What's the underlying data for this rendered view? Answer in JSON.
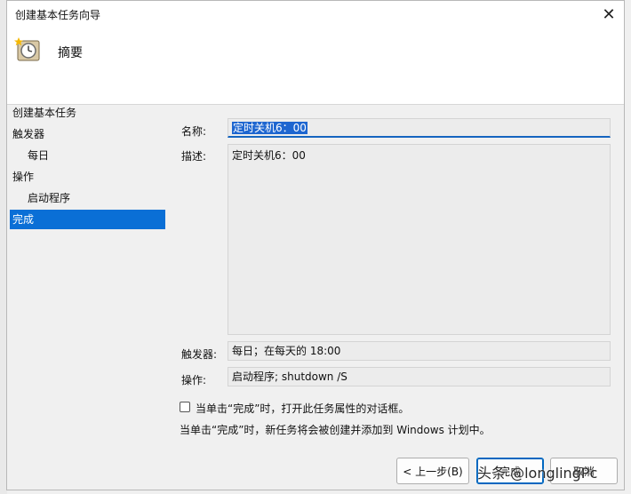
{
  "window": {
    "title": "创建基本任务向导",
    "close_glyph": "✕"
  },
  "header": {
    "title": "摘要",
    "icon": "clock-schedule-icon"
  },
  "nav": {
    "items": [
      {
        "label": "创建基本任务",
        "level": 0,
        "active": false
      },
      {
        "label": "触发器",
        "level": 0,
        "active": false
      },
      {
        "label": "每日",
        "level": 1,
        "active": false
      },
      {
        "label": "操作",
        "level": 0,
        "active": false
      },
      {
        "label": "启动程序",
        "level": 1,
        "active": false
      },
      {
        "label": "完成",
        "level": 0,
        "active": true
      }
    ]
  },
  "form": {
    "name_label": "名称:",
    "name_value": "定时关机6：00",
    "desc_label": "描述:",
    "desc_value": "定时关机6：00",
    "trigger_label": "触发器:",
    "trigger_value": "每日；在每天的 18:00",
    "action_label": "操作:",
    "action_value": "启动程序; shutdown /S"
  },
  "checkbox": {
    "label": "当单击“完成”时，打开此任务属性的对话框。",
    "checked": false
  },
  "info_text": "当单击“完成”时，新任务将会被创建并添加到 Windows 计划中。",
  "buttons": {
    "back": "< 上一步(B)",
    "finish": "完成",
    "cancel": "取消"
  },
  "watermark": "头条 @longlingPc",
  "colors": {
    "accent": "#0a6fd6",
    "selection": "#1e66d0"
  }
}
